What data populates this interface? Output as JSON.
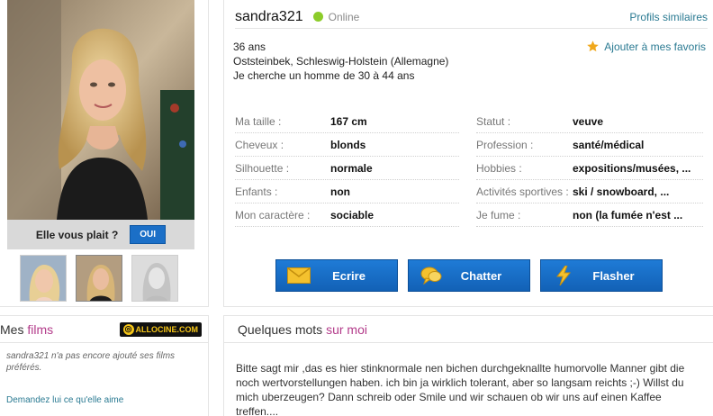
{
  "profile": {
    "username": "sandra321",
    "status": "Online",
    "similar_link": "Profils similaires",
    "age": "36 ans",
    "location": "Oststeinbek, Schleswig-Holstein (Allemagne)",
    "seeking": "Je cherche un homme de 30 à 44 ans",
    "favorite_link": "Ajouter à mes favoris"
  },
  "photo_panel": {
    "like_question": "Elle vous plait ?",
    "like_button": "OUI"
  },
  "attributes_left": [
    {
      "label": "Ma taille :",
      "value": "167 cm"
    },
    {
      "label": "Cheveux :",
      "value": "blonds"
    },
    {
      "label": "Silhouette :",
      "value": "normale"
    },
    {
      "label": "Enfants :",
      "value": "non"
    },
    {
      "label": "Mon caractère :",
      "value": "sociable"
    }
  ],
  "attributes_right": [
    {
      "label": "Statut :",
      "value": "veuve"
    },
    {
      "label": "Profession :",
      "value": "santé/médical"
    },
    {
      "label": "Hobbies :",
      "value": "expositions/musées, ..."
    },
    {
      "label": "Activités sportives :",
      "value": "ski / snowboard, ..."
    },
    {
      "label": "Je fume :",
      "value": "non (la fumée n'est ..."
    }
  ],
  "actions": {
    "write": "Ecrire",
    "chat": "Chatter",
    "flash": "Flasher"
  },
  "films": {
    "title_prefix": "Mes ",
    "title_accent": "films",
    "badge": "ALLOCINE.COM",
    "empty_text": "sandra321 n'a pas encore ajouté ses films préférés.",
    "ask_link": "Demandez lui ce qu'elle aime"
  },
  "about": {
    "title_prefix": "Quelques mots ",
    "title_accent": "sur moi",
    "text": "Bitte sagt mir ,das es hier stinknormale nen bichen durchgeknallte humorvolle Manner gibt die noch wertvorstellungen haben. ich bin ja wirklich tolerant, aber so langsam reichts ;-) Willst du mich uberzeugen? Dann schreib oder Smile und wir schauen ob wir uns auf einen Kaffee treffen...."
  },
  "colors": {
    "accent_blue": "#1b6fc7",
    "link": "#2a7a92",
    "online": "#8ccc2a",
    "accent_pink": "#b33b8a"
  },
  "icons": [
    "star-icon",
    "envelope-icon",
    "chat-bubble-icon",
    "lightning-icon",
    "allocine-logo"
  ]
}
